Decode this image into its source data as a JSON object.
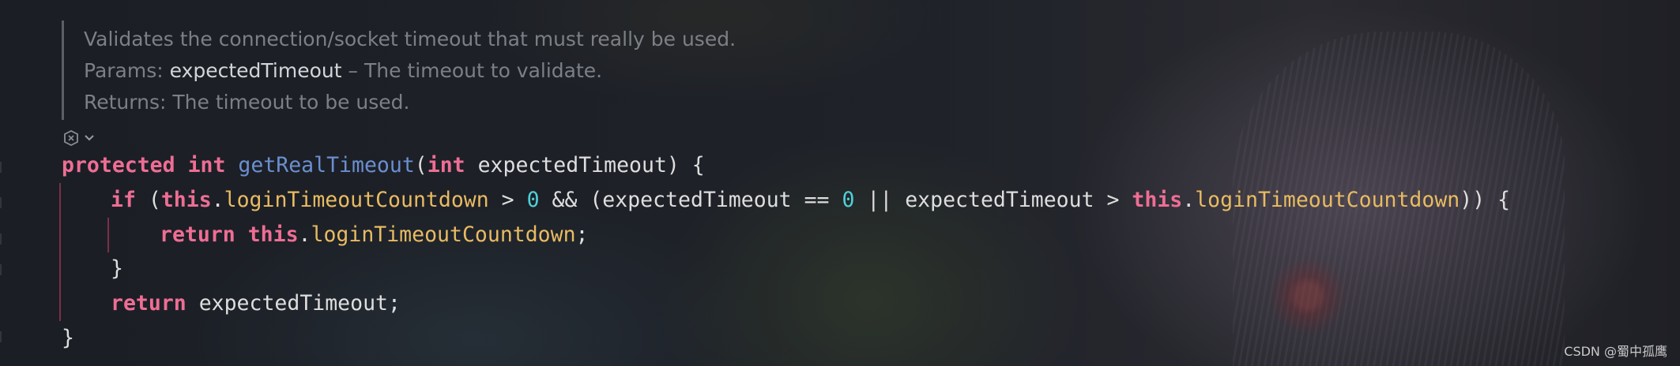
{
  "doc_comment": {
    "summary": "Validates the connection/socket timeout that must really be used.",
    "params_label": "Params:",
    "param_name": "expectedTimeout",
    "param_desc": "– The timeout to validate.",
    "returns_label": "Returns:",
    "returns_desc": "The timeout to be used."
  },
  "inlay_icons": [
    "ai-assistant-icon",
    "chevron-down-icon"
  ],
  "code": {
    "l1": {
      "kw1": "protected",
      "type": "int",
      "fn": "getRealTimeout",
      "open": "(",
      "ptype": "int",
      "rest": " expectedTimeout) {"
    },
    "l2": {
      "kw_if": "if",
      "p1": " (",
      "this1": "this",
      "dot1": ".",
      "f1": "loginTimeoutCountdown",
      "op1": " > ",
      "n1": "0",
      "op2": " && (expectedTimeout == ",
      "n2": "0",
      "op3": " || expectedTimeout > ",
      "this2": "this",
      "dot2": ".",
      "f2": "loginTimeoutCountdown",
      "close": ")) {"
    },
    "l3": {
      "ret": "return",
      "sp": " ",
      "this": "this",
      "dot": ".",
      "f": "loginTimeoutCountdown",
      "semi": ";"
    },
    "l4": "}",
    "l5": {
      "ret": "return",
      "rest": " expectedTimeout;"
    },
    "l6": "}"
  },
  "watermark": "CSDN @蜀中孤鹰"
}
